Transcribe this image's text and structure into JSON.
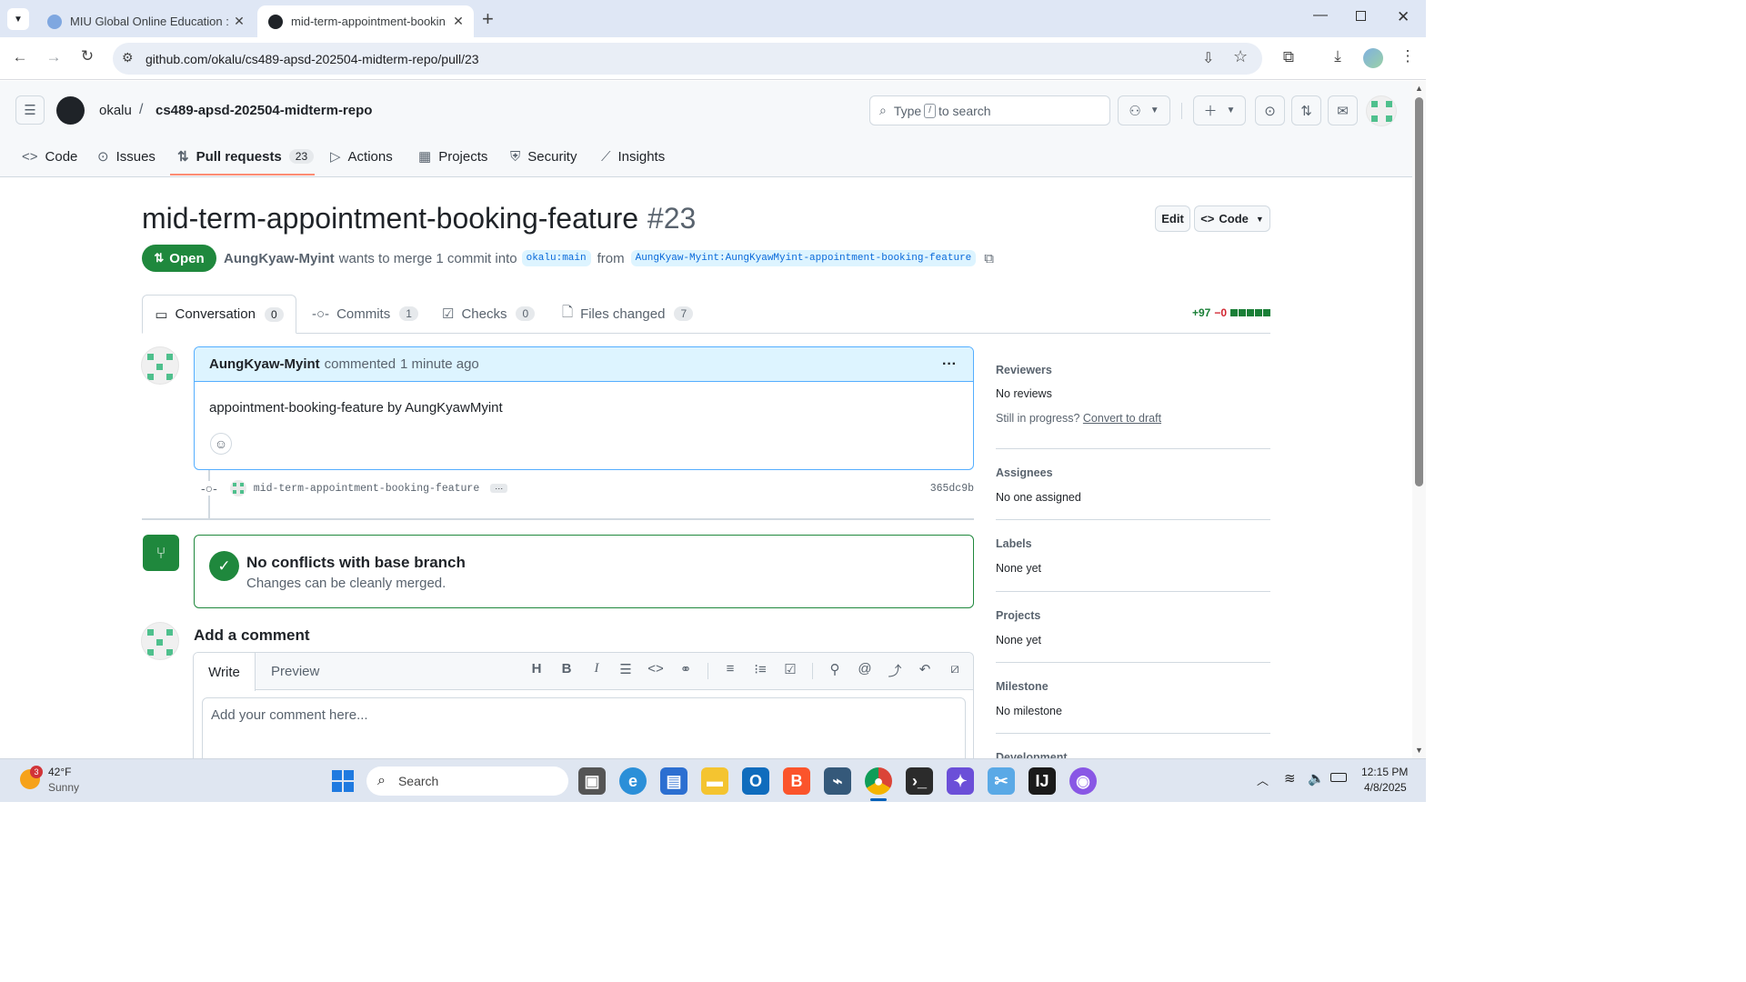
{
  "browser": {
    "tabs": [
      {
        "title": "MIU Global Online Education : C"
      },
      {
        "title": "mid-term-appointment-bookin"
      }
    ],
    "new_tab": "+",
    "url": "github.com/okalu/cs489-apsd-202504-midterm-repo/pull/23"
  },
  "github": {
    "owner": "okalu",
    "separator": "/",
    "repo": "cs489-apsd-202504-midterm-repo",
    "search_pre": "Type",
    "search_key": "/",
    "search_post": "to search",
    "nav": [
      {
        "label": "Code",
        "icon": "code-icon"
      },
      {
        "label": "Issues",
        "icon": "issue-icon"
      },
      {
        "label": "Pull requests",
        "count": "23",
        "icon": "pull-request-icon"
      },
      {
        "label": "Actions",
        "icon": "play-icon"
      },
      {
        "label": "Projects",
        "icon": "table-icon"
      },
      {
        "label": "Security",
        "icon": "shield-icon"
      },
      {
        "label": "Insights",
        "icon": "graph-icon"
      }
    ]
  },
  "pr": {
    "title": "mid-term-appointment-booking-feature",
    "number": "#23",
    "edit": "Edit",
    "code": "Code",
    "state": "Open",
    "author": "AungKyaw-Myint",
    "meta1": "wants to merge 1 commit into",
    "base": "okalu:main",
    "from": "from",
    "head": "AungKyaw-Myint:AungKyawMyint-appointment-booking-feature",
    "tabs": [
      {
        "label": "Conversation",
        "count": "0"
      },
      {
        "label": "Commits",
        "count": "1"
      },
      {
        "label": "Checks",
        "count": "0"
      },
      {
        "label": "Files changed",
        "count": "7"
      }
    ],
    "additions": "+97",
    "deletions": "−0",
    "diff_blocks": 5
  },
  "comment": {
    "author": "AungKyaw-Myint",
    "action": "commented",
    "time": "1 minute ago",
    "body": "appointment-booking-feature by AungKyawMyint",
    "more": "···"
  },
  "commit": {
    "message": "mid-term-appointment-booking-feature",
    "ellipsis": "···",
    "sha": "365dc9b"
  },
  "merge": {
    "title": "No conflicts with base branch",
    "subtitle": "Changes can be cleanly merged."
  },
  "add_comment": {
    "heading": "Add a comment",
    "write": "Write",
    "preview": "Preview",
    "placeholder": "Add your comment here..."
  },
  "sidebar": {
    "reviewers_h": "Reviewers",
    "reviewers_v": "No reviews",
    "progress": "Still in progress?",
    "draft_link": "Convert to draft",
    "assignees_h": "Assignees",
    "assignees_v": "No one assigned",
    "labels_h": "Labels",
    "labels_v": "None yet",
    "projects_h": "Projects",
    "projects_v": "None yet",
    "milestone_h": "Milestone",
    "milestone_v": "No milestone",
    "development_h": "Development"
  },
  "taskbar": {
    "badge": "3",
    "temp": "42°F",
    "weather": "Sunny",
    "search": "Search",
    "time": "12:15 PM",
    "date": "4/8/2025"
  },
  "colors": {
    "open_green": "#1f883d",
    "link_blue": "#0969da",
    "accent_orange": "#fd8c73"
  }
}
